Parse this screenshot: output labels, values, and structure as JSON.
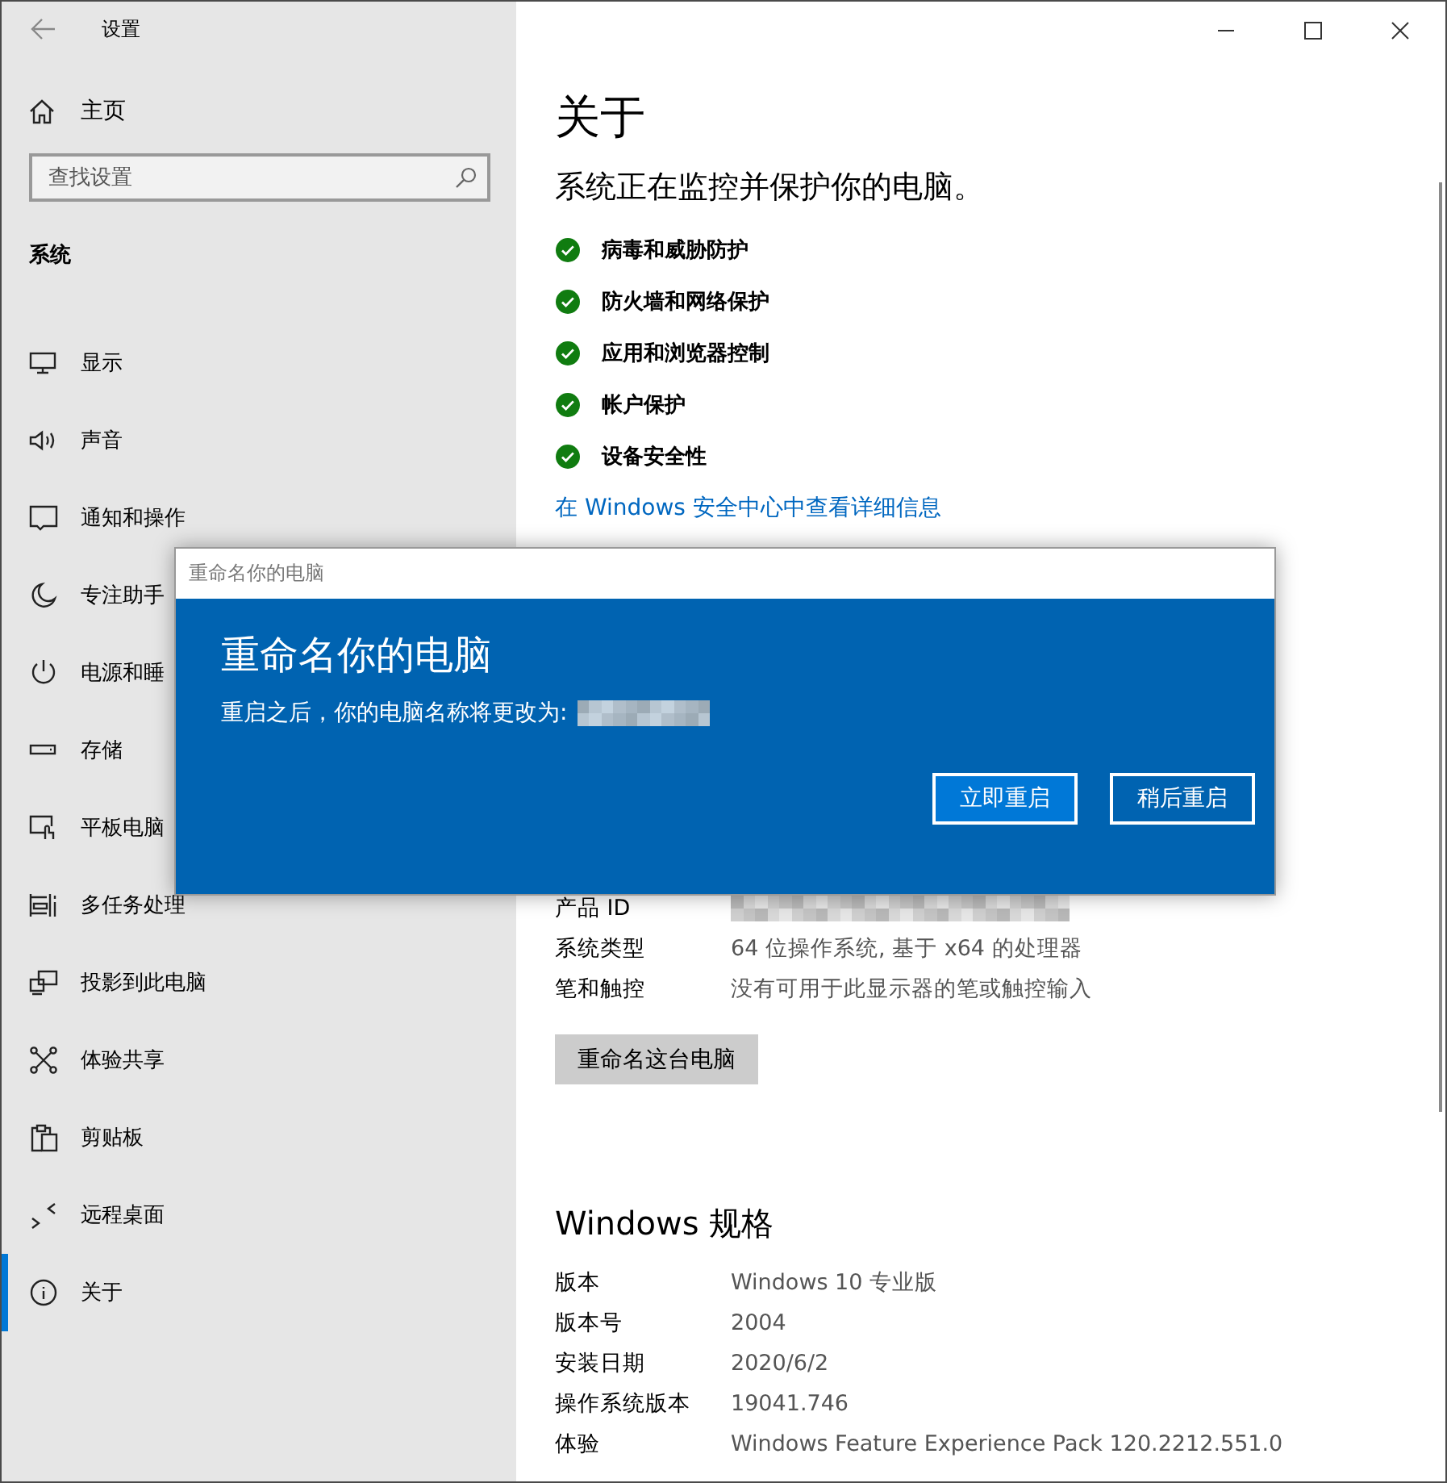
{
  "window": {
    "title": "设置"
  },
  "sidebar": {
    "home": "主页",
    "search": {
      "placeholder": "查找设置"
    },
    "section": "系统",
    "items": [
      {
        "label": "显示",
        "selected": false
      },
      {
        "label": "声音",
        "selected": false
      },
      {
        "label": "通知和操作",
        "selected": false
      },
      {
        "label": "专注助手",
        "selected": false
      },
      {
        "label": "电源和睡",
        "selected": false
      },
      {
        "label": "存储",
        "selected": false
      },
      {
        "label": "平板电脑",
        "selected": false
      },
      {
        "label": "多任务处理",
        "selected": false
      },
      {
        "label": "投影到此电脑",
        "selected": false
      },
      {
        "label": "体验共享",
        "selected": false
      },
      {
        "label": "剪贴板",
        "selected": false
      },
      {
        "label": "远程桌面",
        "selected": false
      },
      {
        "label": "关于",
        "selected": true
      }
    ]
  },
  "content": {
    "title": "关于",
    "subtitle": "系统正在监控并保护你的电脑。",
    "protections": [
      {
        "label": "病毒和威胁防护",
        "ok": true
      },
      {
        "label": "防火墙和网络保护",
        "ok": true
      },
      {
        "label": "应用和浏览器控制",
        "ok": true
      },
      {
        "label": "帐户保护",
        "ok": true
      },
      {
        "label": "设备安全性",
        "ok": true
      }
    ],
    "security_link": "在 Windows 安全中心中查看详细信息",
    "device_specs": [
      {
        "label": "产品 ID",
        "redacted": true
      },
      {
        "label": "系统类型",
        "value": "64 位操作系统, 基于 x64 的处理器",
        "redacted": false
      },
      {
        "label": "笔和触控",
        "value": "没有可用于此显示器的笔或触控输入",
        "redacted": false
      }
    ],
    "rename_button": "重命名这台电脑",
    "windows_title": "Windows 规格",
    "windows_specs": [
      {
        "label": "版本",
        "value": "Windows 10 专业版"
      },
      {
        "label": "版本号",
        "value": "2004"
      },
      {
        "label": "安装日期",
        "value": "2020/6/2"
      },
      {
        "label": "操作系统版本",
        "value": "19041.746"
      },
      {
        "label": "体验",
        "value": "Windows Feature Experience Pack 120.2212.551.0"
      }
    ]
  },
  "dialog": {
    "title": "重命名你的电脑",
    "heading": "重命名你的电脑",
    "message": "重启之后，你的电脑名称将更改为:",
    "name_redacted": true,
    "buttons": [
      {
        "label": "立即重启",
        "default": true
      },
      {
        "label": "稍后重启",
        "default": false
      }
    ]
  }
}
